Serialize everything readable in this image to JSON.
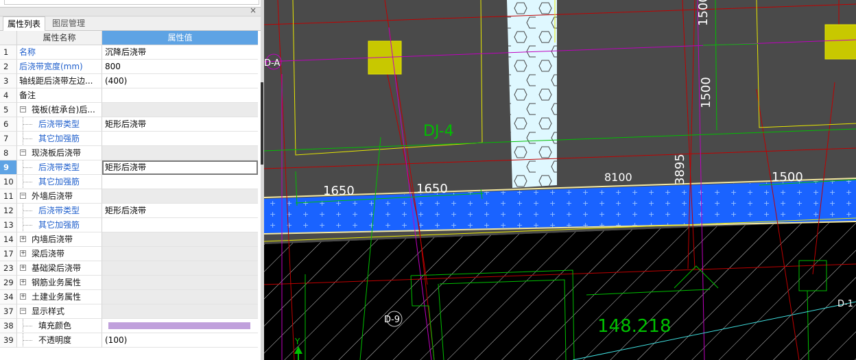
{
  "panel": {
    "close_glyph": "×",
    "tabs": [
      {
        "label": "属性列表",
        "active": true
      },
      {
        "label": "图层管理",
        "active": false
      }
    ],
    "header": {
      "name_col": "属性名称",
      "value_col": "属性值"
    },
    "rows": [
      {
        "num": "1",
        "name": "名称",
        "value": "沉降后浇带",
        "style": "blue",
        "level": 0,
        "toggle": ""
      },
      {
        "num": "2",
        "name": "后浇带宽度(mm)",
        "value": "800",
        "style": "blue",
        "level": 0,
        "toggle": ""
      },
      {
        "num": "3",
        "name": "轴线距后浇带左边...",
        "value": "(400)",
        "style": "black",
        "level": 0,
        "toggle": ""
      },
      {
        "num": "4",
        "name": "备注",
        "value": "",
        "style": "black",
        "level": 0,
        "toggle": ""
      },
      {
        "num": "5",
        "name": "筏板(桩承台)后...",
        "value": "",
        "style": "black",
        "level": 0,
        "toggle": "−",
        "gray": true
      },
      {
        "num": "6",
        "name": "后浇带类型",
        "value": "矩形后浇带",
        "style": "blue",
        "level": 1,
        "toggle": ""
      },
      {
        "num": "7",
        "name": "其它加强筋",
        "value": "",
        "style": "blue",
        "level": 1,
        "toggle": ""
      },
      {
        "num": "8",
        "name": "现浇板后浇带",
        "value": "",
        "style": "black",
        "level": 0,
        "toggle": "−",
        "gray": true
      },
      {
        "num": "9",
        "name": "后浇带类型",
        "value": "矩形后浇带",
        "style": "blue",
        "level": 1,
        "toggle": "",
        "selected": true
      },
      {
        "num": "10",
        "name": "其它加强筋",
        "value": "",
        "style": "blue",
        "level": 1,
        "toggle": ""
      },
      {
        "num": "11",
        "name": "外墙后浇带",
        "value": "",
        "style": "black",
        "level": 0,
        "toggle": "−",
        "gray": true
      },
      {
        "num": "12",
        "name": "后浇带类型",
        "value": "矩形后浇带",
        "style": "blue",
        "level": 1,
        "toggle": ""
      },
      {
        "num": "13",
        "name": "其它加强筋",
        "value": "",
        "style": "blue",
        "level": 1,
        "toggle": ""
      },
      {
        "num": "14",
        "name": "内墙后浇带",
        "value": "",
        "style": "black",
        "level": 0,
        "toggle": "+",
        "gray": true
      },
      {
        "num": "17",
        "name": "梁后浇带",
        "value": "",
        "style": "black",
        "level": 0,
        "toggle": "+",
        "gray": true
      },
      {
        "num": "23",
        "name": "基础梁后浇带",
        "value": "",
        "style": "black",
        "level": 0,
        "toggle": "+",
        "gray": true
      },
      {
        "num": "29",
        "name": "钢筋业务属性",
        "value": "",
        "style": "black",
        "level": 0,
        "toggle": "+",
        "gray": true
      },
      {
        "num": "34",
        "name": "土建业务属性",
        "value": "",
        "style": "black",
        "level": 0,
        "toggle": "+",
        "gray": true
      },
      {
        "num": "37",
        "name": "显示样式",
        "value": "",
        "style": "black",
        "level": 0,
        "toggle": "−",
        "gray": true
      },
      {
        "num": "38",
        "name": "填充颜色",
        "value": "",
        "style": "black",
        "level": 1,
        "toggle": "",
        "swatch": "#c0a0dc"
      },
      {
        "num": "39",
        "name": "不透明度",
        "value": "(100)",
        "style": "black",
        "level": 1,
        "toggle": ""
      }
    ]
  },
  "cad": {
    "labels": {
      "da": "D-A",
      "dj4": "DJ-4",
      "d9": "D-9",
      "d1": "D-1",
      "elev": "148.218",
      "y_axis": "Y"
    },
    "dims": {
      "d1650a": "1650",
      "d1650b": "1650",
      "d8100": "8100",
      "d3895": "3895",
      "d1500a": "1500",
      "d1500b": "1500",
      "d1500c": "1500"
    },
    "colors": {
      "background": "#4a4a4a",
      "band": "#1a63ff",
      "soil": "#000000",
      "strip": "#dff8ff",
      "yellow": "#e8e800",
      "green": "#00c000",
      "red": "#c00000",
      "magenta": "#c000c0"
    }
  }
}
